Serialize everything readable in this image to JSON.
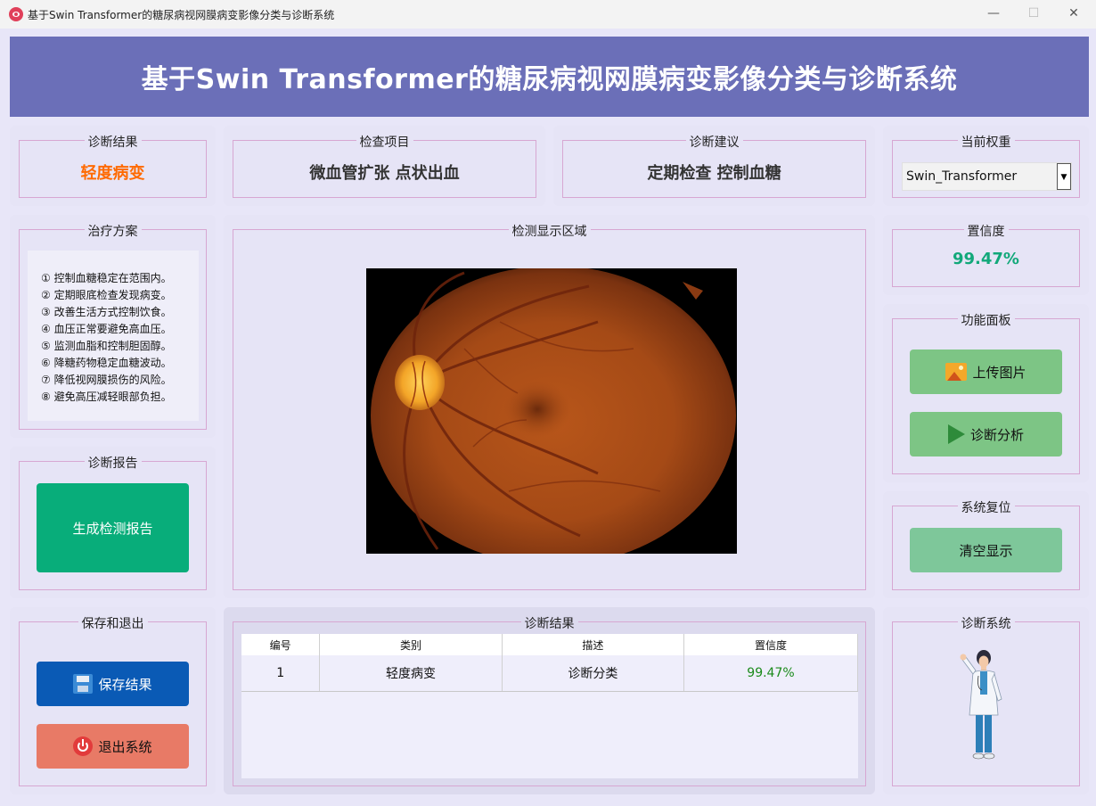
{
  "window": {
    "title": "基于Swin Transformer的糖尿病视网膜病变影像分类与诊断系统",
    "minimize": "—",
    "maximize": "☐",
    "close": "✕"
  },
  "header": {
    "title": "基于Swin Transformer的糖尿病视网膜病变影像分类与诊断系统"
  },
  "result_box": {
    "legend": "诊断结果",
    "value": "轻度病变"
  },
  "exam_box": {
    "legend": "检查项目",
    "value": "微血管扩张 点状出血"
  },
  "advice_box": {
    "legend": "诊断建议",
    "value": "定期检查 控制血糖"
  },
  "weight_box": {
    "legend": "当前权重",
    "selected": "Swin_Transformer",
    "arrow": "▼"
  },
  "treatment": {
    "legend": "治疗方案",
    "items": [
      "① 控制血糖稳定在范围内。",
      "② 定期眼底检查发现病变。",
      "③ 改善生活方式控制饮食。",
      "④ 血压正常要避免高血压。",
      "⑤ 监测血脂和控制胆固醇。",
      "⑥ 降糖药物稳定血糖波动。",
      "⑦ 降低视网膜损伤的风险。",
      "⑧ 避免高压减轻眼部负担。"
    ]
  },
  "display": {
    "legend": "检测显示区域"
  },
  "confidence_box": {
    "legend": "置信度",
    "value": "99.47%"
  },
  "function_panel": {
    "legend": "功能面板",
    "upload_label": "上传图片",
    "diagnose_label": "诊断分析"
  },
  "report": {
    "legend": "诊断报告",
    "generate_label": "生成检测报告"
  },
  "reset": {
    "legend": "系统复位",
    "clear_label": "清空显示"
  },
  "save_exit": {
    "legend": "保存和退出",
    "save_label": "保存结果",
    "exit_label": "退出系统"
  },
  "results_table": {
    "legend": "诊断结果",
    "columns": [
      "编号",
      "类别",
      "描述",
      "置信度"
    ],
    "rows": [
      {
        "id": "1",
        "category": "轻度病变",
        "desc": "诊断分类",
        "conf": "99.47%"
      }
    ]
  },
  "mascot": {
    "legend": "诊断系统"
  },
  "colors": {
    "banner": "#6b6fb8",
    "accent_orange": "#ff6a00",
    "accent_green": "#12a87a",
    "report_btn": "#08ad7a",
    "save_btn": "#0a5ab5",
    "exit_btn": "#e87a66",
    "func_btn": "#7dc585"
  }
}
